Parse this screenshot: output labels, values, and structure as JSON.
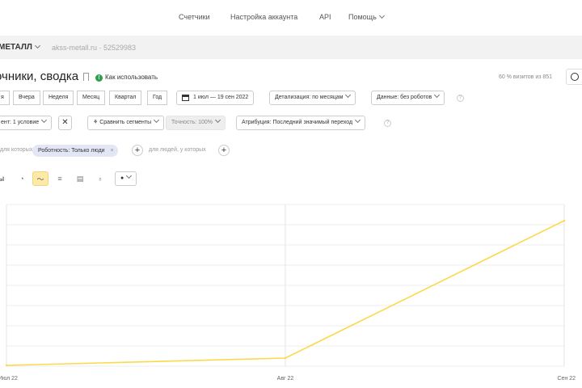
{
  "topnav": {
    "items": [
      {
        "label": "Счетчики"
      },
      {
        "label": "Настройка аккаунта"
      },
      {
        "label": "API"
      },
      {
        "label": "Помощь"
      }
    ]
  },
  "counter": {
    "name": "МЕТАЛЛ",
    "site": "akss-metall.ru · 52529983"
  },
  "header": {
    "title": "очники, сводка",
    "how_to": "Как использовать",
    "visits_note": "60 % визитов из 851"
  },
  "periods": [
    "я",
    "Вчера",
    "Неделя",
    "Месяц",
    "Квартал",
    "Год"
  ],
  "toolbar": {
    "date_range": "1 июл — 19 сен 2022",
    "detail": "Детализация: по месяцам",
    "data": "Данные: без роботов"
  },
  "segments": {
    "segment": "ент: 1 условие",
    "compare": "Сравнить сегменты",
    "accuracy": "Точность: 100%",
    "attribution": "Атрибуция: Последний значимый переход"
  },
  "filters": {
    "left_text": "для которых",
    "chip": "Роботность: Только люди",
    "right_text": "для людей, у которых"
  },
  "chart_label_prefix": "ы",
  "colors": {
    "accent": "#f5c518",
    "line": "#fcd94a",
    "success": "#2aa14a"
  },
  "chart_data": {
    "type": "line",
    "categories": [
      "Июл 22",
      "Авг 22",
      "Сен 22"
    ],
    "series": [
      {
        "values": [
          1,
          10,
          180
        ]
      }
    ],
    "ylim": [
      0,
      200
    ],
    "grid": true
  }
}
